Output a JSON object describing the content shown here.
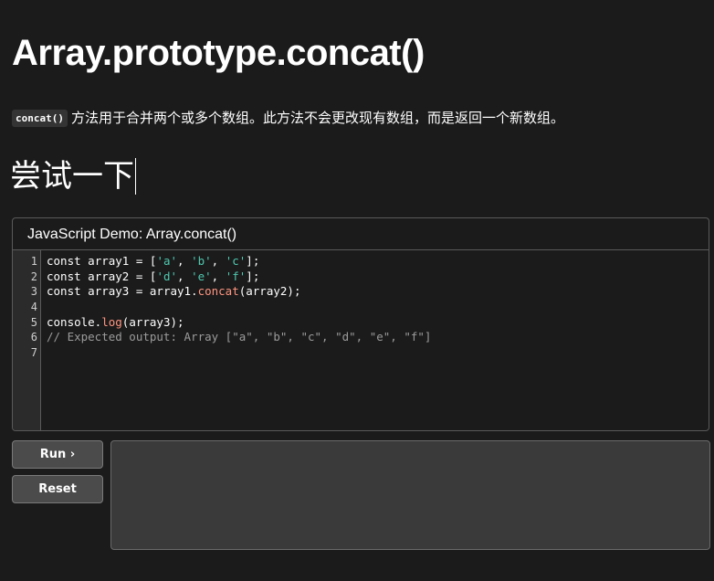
{
  "page": {
    "title": "Array.prototype.concat()",
    "description_code": "concat()",
    "description_text": "方法用于合并两个或多个数组。此方法不会更改现有数组，而是返回一个新数组。",
    "subtitle": "尝试一下"
  },
  "demo": {
    "header": "JavaScript Demo: Array.concat()",
    "line_numbers": [
      "1",
      "2",
      "3",
      "4",
      "5",
      "6",
      "7"
    ],
    "code": {
      "l1": {
        "kw": "const",
        "rest": " array1 = [",
        "s1": "'a'",
        "c1": ", ",
        "s2": "'b'",
        "c2": ", ",
        "s3": "'c'",
        "end": "];"
      },
      "l2": {
        "kw": "const",
        "rest": " array2 = [",
        "s1": "'d'",
        "c1": ", ",
        "s2": "'e'",
        "c2": ", ",
        "s3": "'f'",
        "end": "];"
      },
      "l3": {
        "kw": "const",
        "rest": " array3 = array1.",
        "fn": "concat",
        "end": "(array2);"
      },
      "l5": {
        "obj": "console.",
        "fn": "log",
        "end": "(array3);"
      },
      "l6": {
        "comment": "// Expected output: Array [\"a\", \"b\", \"c\", \"d\", \"e\", \"f\"]"
      }
    }
  },
  "buttons": {
    "run": "Run ›",
    "reset": "Reset"
  },
  "output": {
    "text": ""
  }
}
